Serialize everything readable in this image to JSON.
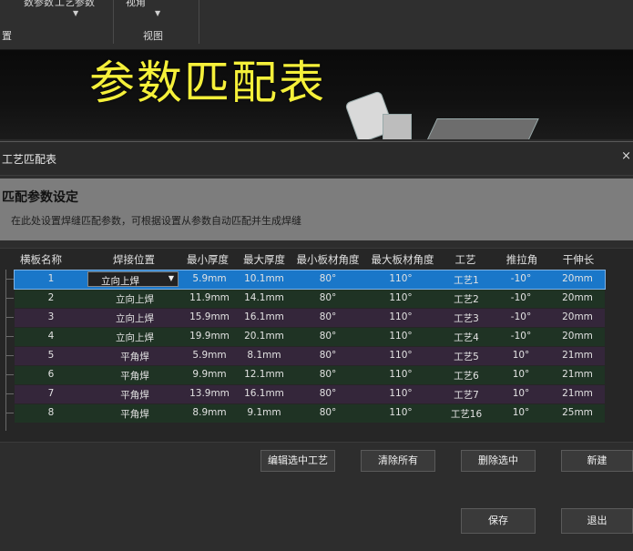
{
  "ribbon": {
    "top_left_label": "数参数",
    "top_mid_label": "工艺参数",
    "top_right_label": "视角",
    "top_right2_label": "视图",
    "group1_label": "置",
    "group2_label": "视图"
  },
  "overlay": {
    "title": "参数匹配表"
  },
  "dialog": {
    "title": "工艺匹配表",
    "close_symbol": "×",
    "heading": "匹配参数设定",
    "subtext": "在此处设置焊缝匹配参数，可根据设置从参数自动匹配并生成焊缝"
  },
  "table": {
    "columns": [
      "横板名称",
      "焊接位置",
      "最小厚度",
      "最大厚度",
      "最小板材角度",
      "最大板材角度",
      "工艺",
      "推拉角",
      "干伸长"
    ],
    "rows": [
      [
        "1",
        "立向上焊",
        "5.9mm",
        "10.1mm",
        "80°",
        "110°",
        "工艺1",
        "-10°",
        "20mm"
      ],
      [
        "2",
        "立向上焊",
        "11.9mm",
        "14.1mm",
        "80°",
        "110°",
        "工艺2",
        "-10°",
        "20mm"
      ],
      [
        "3",
        "立向上焊",
        "15.9mm",
        "16.1mm",
        "80°",
        "110°",
        "工艺3",
        "-10°",
        "20mm"
      ],
      [
        "4",
        "立向上焊",
        "19.9mm",
        "20.1mm",
        "80°",
        "110°",
        "工艺4",
        "-10°",
        "20mm"
      ],
      [
        "5",
        "平角焊",
        "5.9mm",
        "8.1mm",
        "80°",
        "110°",
        "工艺5",
        "10°",
        "21mm"
      ],
      [
        "6",
        "平角焊",
        "9.9mm",
        "12.1mm",
        "80°",
        "110°",
        "工艺6",
        "10°",
        "21mm"
      ],
      [
        "7",
        "平角焊",
        "13.9mm",
        "16.1mm",
        "80°",
        "110°",
        "工艺7",
        "10°",
        "21mm"
      ],
      [
        "8",
        "平角焊",
        "8.9mm",
        "9.1mm",
        "80°",
        "110°",
        "工艺16",
        "10°",
        "25mm"
      ]
    ],
    "selected_row": 0
  },
  "buttons": {
    "edit_selected": "编辑选中工艺",
    "clear_all": "清除所有",
    "delete_selected": "删除选中",
    "new": "新建",
    "save": "保存",
    "exit": "退出"
  },
  "colors": {
    "overlay_text": "#f5f03a",
    "selected_row": "#1a77c9",
    "row_green": "#1f3324",
    "row_purple": "#34263a"
  }
}
